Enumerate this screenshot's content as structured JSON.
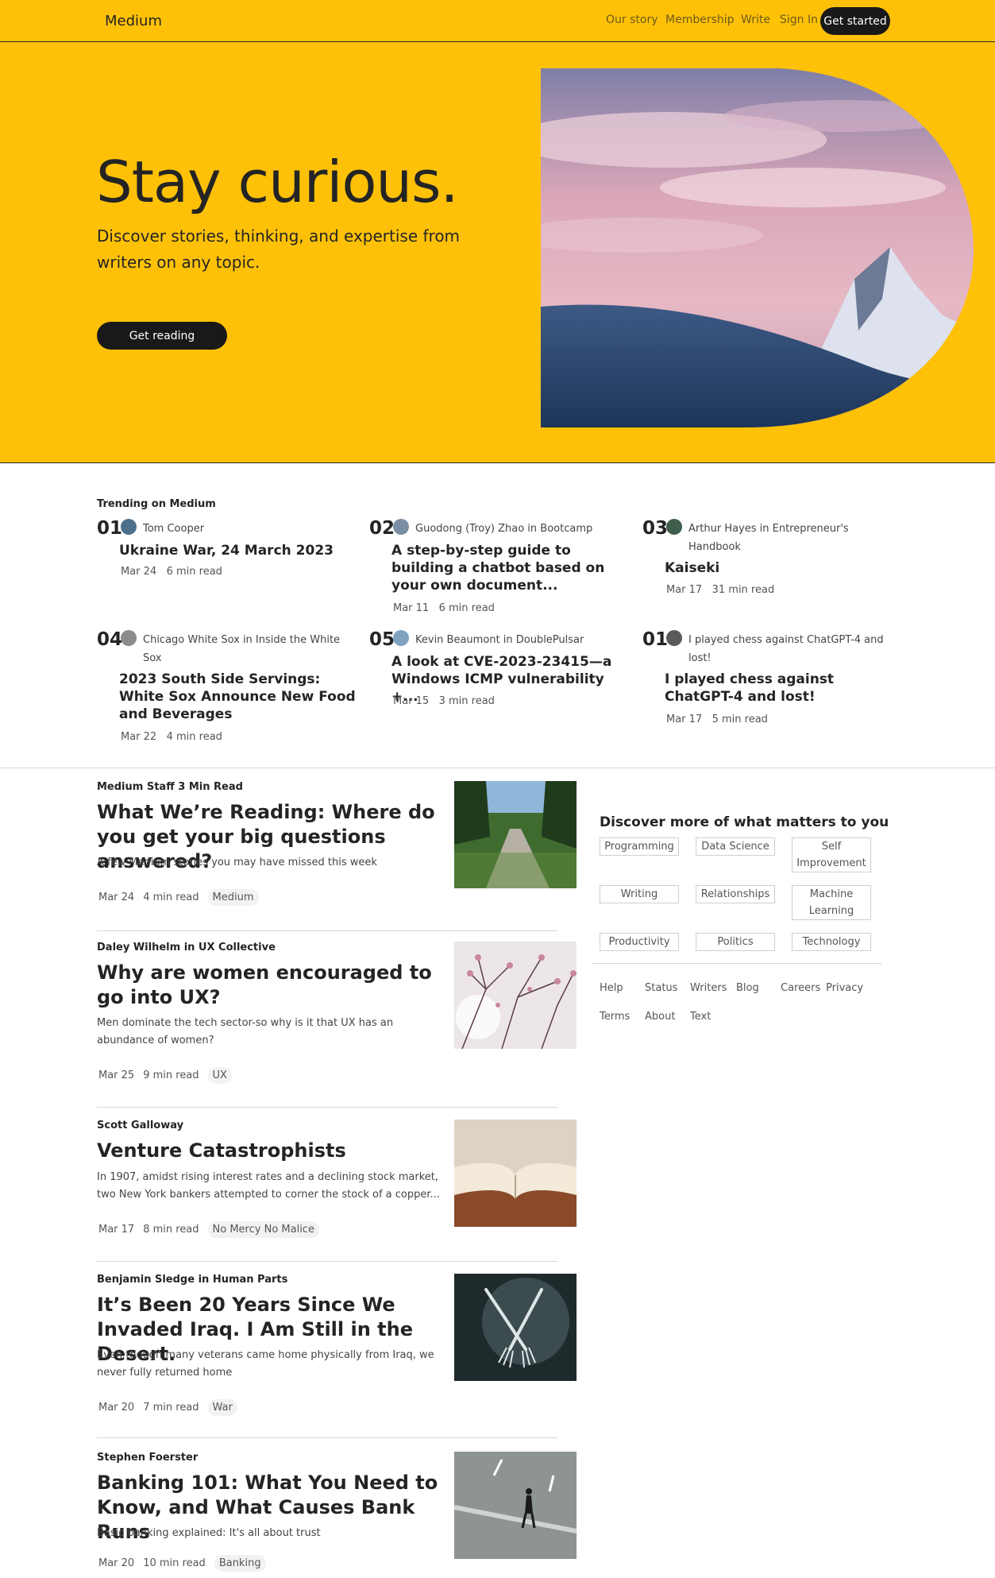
{
  "nav": {
    "brand": "Medium",
    "links": [
      "Our story",
      "Membership",
      "Write",
      "Sign In"
    ],
    "cta": "Get started"
  },
  "hero": {
    "title": "Stay curious.",
    "subtitle": "Discover stories, thinking, and expertise from writers on any topic.",
    "button": "Get reading"
  },
  "trending": {
    "heading": "Trending on Medium",
    "items": [
      {
        "num": "01",
        "author": "Tom Cooper",
        "title": "Ukraine War, 24 March 2023",
        "date": "Mar 24",
        "read": "6 min read"
      },
      {
        "num": "02",
        "author": "Guodong (Troy) Zhao in Bootcamp",
        "title": "A step-by-step guide to building a chatbot based on your own document...",
        "date": "Mar 11",
        "read": "6 min read"
      },
      {
        "num": "03",
        "author": "Arthur Hayes in Entrepreneur's Handbook",
        "title": "Kaiseki",
        "date": "Mar 17",
        "read": "31 min read"
      },
      {
        "num": "04",
        "author": "Chicago White Sox in Inside the White Sox",
        "title": "2023 South Side Servings: White Sox Announce New Food and Beverages",
        "date": "Mar 22",
        "read": "4 min read"
      },
      {
        "num": "05",
        "author": "Kevin Beaumont in DoublePulsar",
        "title": "A look at CVE-2023-23415—a Windows ICMP vulnerability +...",
        "date": "Mar 15",
        "read": "3 min read"
      },
      {
        "num": "01",
        "author": "I played chess against ChatGPT-4 and lost!",
        "title": "I played chess against ChatGPT-4 and lost!",
        "date": "Mar 17",
        "read": "5 min read"
      }
    ]
  },
  "feed": [
    {
      "author": "Medium Staff 3 Min Read",
      "title": "What We’re Reading: Where do you get your big questions answered?",
      "desc": "A few Medium stories you may have missed this week",
      "date": "Mar 24",
      "read": "4 min read",
      "tag": "Medium"
    },
    {
      "author": "Daley Wilhelm in UX Collective",
      "title": "Why are women encouraged to go into UX?",
      "desc": "Men dominate the tech sector-so why is it that UX has an abundance of women?",
      "date": "Mar 25",
      "read": "9 min read",
      "tag": "UX"
    },
    {
      "author": "Scott Galloway",
      "title": "Venture Catastrophists",
      "desc": "In 1907, amidst rising interest rates and a declining stock market, two New York bankers attempted to corner the stock of a copper...",
      "date": "Mar 17",
      "read": "8 min read",
      "tag": "No Mercy No Malice"
    },
    {
      "author": "Benjamin Sledge in Human Parts",
      "title": "It’s Been 20 Years Since We Invaded Iraq. I Am Still in the Desert.",
      "desc": "Even though many veterans came home physically from Iraq, we never fully returned home",
      "date": "Mar 20",
      "read": "7 min read",
      "tag": "War"
    },
    {
      "author": "Stephen Foerster",
      "title": "Banking 101: What You Need to Know, and What Causes Bank Runs",
      "desc": "Basic banking explained: It's all about trust",
      "date": "Mar 20",
      "read": "10 min read",
      "tag": "Banking"
    }
  ],
  "sidebar": {
    "title": "Discover more of what matters to you",
    "topics": [
      "Programming",
      "Data Science",
      "Self Improvement",
      "Writing",
      "Relationships",
      "Machine Learning",
      "Productivity",
      "Politics",
      "Technology"
    ],
    "footer": [
      "Help",
      "Status",
      "Writers",
      "Blog",
      "Careers",
      "Privacy",
      "Terms",
      "About",
      "Text"
    ]
  },
  "colors": {
    "accent": "#ffc107",
    "dark": "#191919"
  }
}
